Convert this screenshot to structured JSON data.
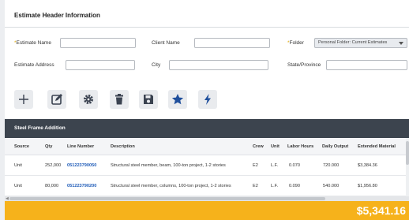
{
  "header": {
    "title": "Estimate Header Information"
  },
  "form": {
    "estimate_name_label": "Estimate Name",
    "client_name_label": "Client Name",
    "folder_label": "Folder",
    "folder_required_mark": "*",
    "estimate_name_required_mark": "*",
    "folder_value": "Personal Folder: Current Estimates",
    "estimate_address_label": "Estimate Address",
    "city_label": "City",
    "state_label": "State/Province"
  },
  "toolbar": {
    "icons": [
      "plus-icon",
      "edit-icon",
      "gear-icon",
      "trash-icon",
      "save-icon",
      "star-icon",
      "lightning-icon"
    ],
    "accent_color": "#1f4f9c"
  },
  "section": {
    "title": "Steel Frame Addition"
  },
  "table": {
    "columns": [
      "Source",
      "Qty",
      "Line Number",
      "Description",
      "Crew",
      "Unit",
      "Labor Hours",
      "Daily Output",
      "Extended Material"
    ],
    "rows": [
      [
        "Unit",
        "252,000",
        "051223790050",
        "Structural steel member, beam, 100-ton project, 1-2 stories",
        "E2",
        "L.F.",
        "0.070",
        "720.000",
        "$3,384.36"
      ],
      [
        "Unit",
        "80,000",
        "051223790200",
        "Structural steel member, columns, 100-ton project, 1-2 stories",
        "E2",
        "L.F.",
        "0.090",
        "540.000",
        "$1,956.80"
      ]
    ]
  },
  "footer": {
    "total": "$5,341.16",
    "color": "#f6b21b"
  }
}
